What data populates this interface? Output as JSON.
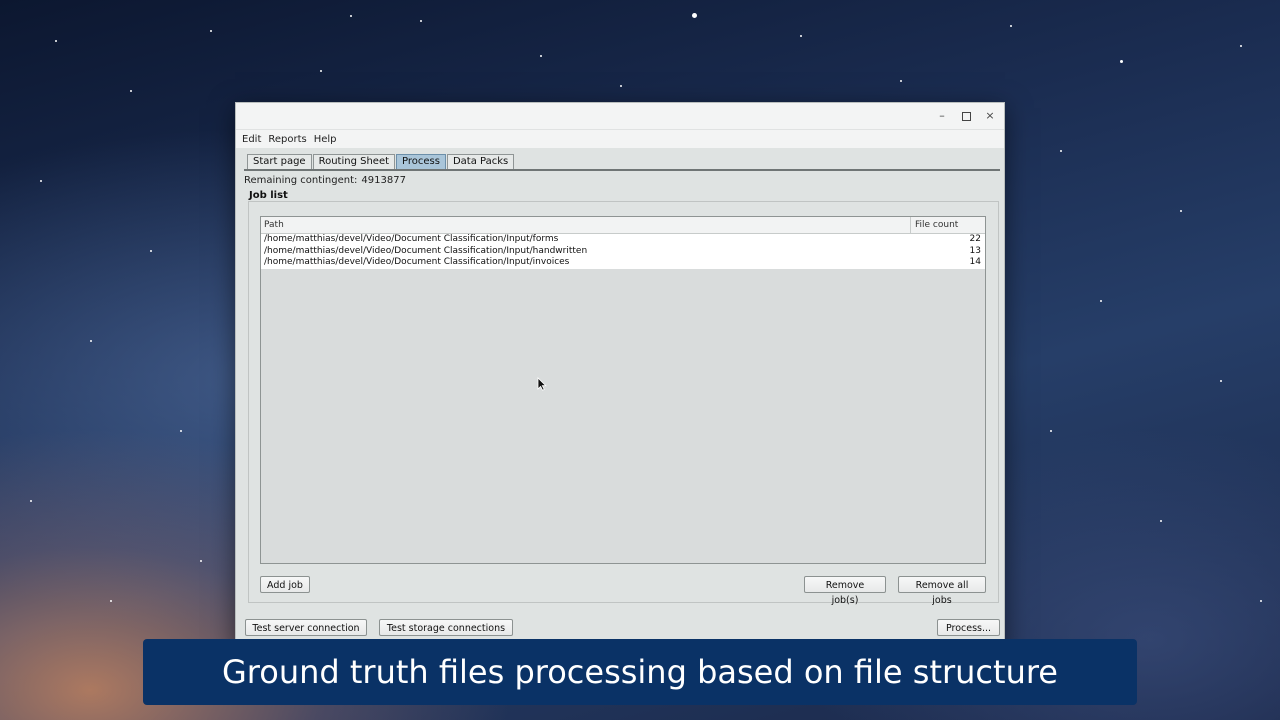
{
  "window": {
    "controls": {
      "minimize": "–",
      "close": "×"
    }
  },
  "menubar": {
    "items": [
      "Edit",
      "Reports",
      "Help"
    ]
  },
  "tabs": [
    {
      "label": "Start page",
      "active": false
    },
    {
      "label": "Routing Sheet",
      "active": false
    },
    {
      "label": "Process",
      "active": true
    },
    {
      "label": "Data Packs",
      "active": false
    }
  ],
  "status": {
    "remaining_label": "Remaining contingent:",
    "remaining_value": "4913877"
  },
  "job_list": {
    "title": "Job list",
    "columns": [
      "Path",
      "File count"
    ],
    "rows": [
      {
        "path": "/home/matthias/devel/Video/Document Classification/Input/forms",
        "count": "22"
      },
      {
        "path": "/home/matthias/devel/Video/Document Classification/Input/handwritten",
        "count": "13"
      },
      {
        "path": "/home/matthias/devel/Video/Document Classification/Input/invoices",
        "count": "14"
      }
    ],
    "buttons": {
      "add": "Add job",
      "remove": "Remove job(s)",
      "remove_all": "Remove all jobs"
    }
  },
  "footer": {
    "test_server": "Test server connection",
    "test_storage": "Test storage connections",
    "process": "Process..."
  },
  "caption": "Ground truth files processing based on file structure",
  "colors": {
    "active_tab": "#a9c5d9",
    "caption_bg": "#0a3266"
  }
}
